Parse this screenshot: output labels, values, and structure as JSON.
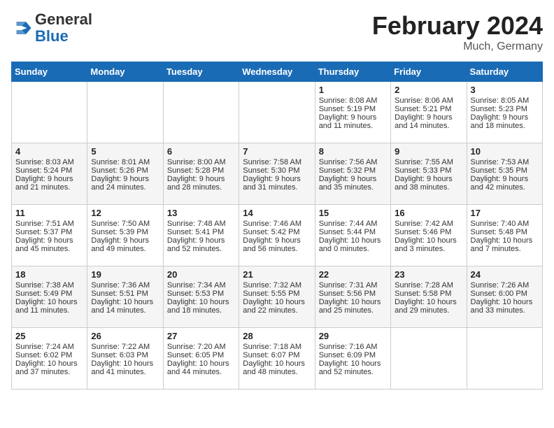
{
  "header": {
    "logo_general": "General",
    "logo_blue": "Blue",
    "title": "February 2024",
    "location": "Much, Germany"
  },
  "weekdays": [
    "Sunday",
    "Monday",
    "Tuesday",
    "Wednesday",
    "Thursday",
    "Friday",
    "Saturday"
  ],
  "weeks": [
    [
      {
        "day": "",
        "info": ""
      },
      {
        "day": "",
        "info": ""
      },
      {
        "day": "",
        "info": ""
      },
      {
        "day": "",
        "info": ""
      },
      {
        "day": "1",
        "info": "Sunrise: 8:08 AM\nSunset: 5:19 PM\nDaylight: 9 hours\nand 11 minutes."
      },
      {
        "day": "2",
        "info": "Sunrise: 8:06 AM\nSunset: 5:21 PM\nDaylight: 9 hours\nand 14 minutes."
      },
      {
        "day": "3",
        "info": "Sunrise: 8:05 AM\nSunset: 5:23 PM\nDaylight: 9 hours\nand 18 minutes."
      }
    ],
    [
      {
        "day": "4",
        "info": "Sunrise: 8:03 AM\nSunset: 5:24 PM\nDaylight: 9 hours\nand 21 minutes."
      },
      {
        "day": "5",
        "info": "Sunrise: 8:01 AM\nSunset: 5:26 PM\nDaylight: 9 hours\nand 24 minutes."
      },
      {
        "day": "6",
        "info": "Sunrise: 8:00 AM\nSunset: 5:28 PM\nDaylight: 9 hours\nand 28 minutes."
      },
      {
        "day": "7",
        "info": "Sunrise: 7:58 AM\nSunset: 5:30 PM\nDaylight: 9 hours\nand 31 minutes."
      },
      {
        "day": "8",
        "info": "Sunrise: 7:56 AM\nSunset: 5:32 PM\nDaylight: 9 hours\nand 35 minutes."
      },
      {
        "day": "9",
        "info": "Sunrise: 7:55 AM\nSunset: 5:33 PM\nDaylight: 9 hours\nand 38 minutes."
      },
      {
        "day": "10",
        "info": "Sunrise: 7:53 AM\nSunset: 5:35 PM\nDaylight: 9 hours\nand 42 minutes."
      }
    ],
    [
      {
        "day": "11",
        "info": "Sunrise: 7:51 AM\nSunset: 5:37 PM\nDaylight: 9 hours\nand 45 minutes."
      },
      {
        "day": "12",
        "info": "Sunrise: 7:50 AM\nSunset: 5:39 PM\nDaylight: 9 hours\nand 49 minutes."
      },
      {
        "day": "13",
        "info": "Sunrise: 7:48 AM\nSunset: 5:41 PM\nDaylight: 9 hours\nand 52 minutes."
      },
      {
        "day": "14",
        "info": "Sunrise: 7:46 AM\nSunset: 5:42 PM\nDaylight: 9 hours\nand 56 minutes."
      },
      {
        "day": "15",
        "info": "Sunrise: 7:44 AM\nSunset: 5:44 PM\nDaylight: 10 hours\nand 0 minutes."
      },
      {
        "day": "16",
        "info": "Sunrise: 7:42 AM\nSunset: 5:46 PM\nDaylight: 10 hours\nand 3 minutes."
      },
      {
        "day": "17",
        "info": "Sunrise: 7:40 AM\nSunset: 5:48 PM\nDaylight: 10 hours\nand 7 minutes."
      }
    ],
    [
      {
        "day": "18",
        "info": "Sunrise: 7:38 AM\nSunset: 5:49 PM\nDaylight: 10 hours\nand 11 minutes."
      },
      {
        "day": "19",
        "info": "Sunrise: 7:36 AM\nSunset: 5:51 PM\nDaylight: 10 hours\nand 14 minutes."
      },
      {
        "day": "20",
        "info": "Sunrise: 7:34 AM\nSunset: 5:53 PM\nDaylight: 10 hours\nand 18 minutes."
      },
      {
        "day": "21",
        "info": "Sunrise: 7:32 AM\nSunset: 5:55 PM\nDaylight: 10 hours\nand 22 minutes."
      },
      {
        "day": "22",
        "info": "Sunrise: 7:31 AM\nSunset: 5:56 PM\nDaylight: 10 hours\nand 25 minutes."
      },
      {
        "day": "23",
        "info": "Sunrise: 7:28 AM\nSunset: 5:58 PM\nDaylight: 10 hours\nand 29 minutes."
      },
      {
        "day": "24",
        "info": "Sunrise: 7:26 AM\nSunset: 6:00 PM\nDaylight: 10 hours\nand 33 minutes."
      }
    ],
    [
      {
        "day": "25",
        "info": "Sunrise: 7:24 AM\nSunset: 6:02 PM\nDaylight: 10 hours\nand 37 minutes."
      },
      {
        "day": "26",
        "info": "Sunrise: 7:22 AM\nSunset: 6:03 PM\nDaylight: 10 hours\nand 41 minutes."
      },
      {
        "day": "27",
        "info": "Sunrise: 7:20 AM\nSunset: 6:05 PM\nDaylight: 10 hours\nand 44 minutes."
      },
      {
        "day": "28",
        "info": "Sunrise: 7:18 AM\nSunset: 6:07 PM\nDaylight: 10 hours\nand 48 minutes."
      },
      {
        "day": "29",
        "info": "Sunrise: 7:16 AM\nSunset: 6:09 PM\nDaylight: 10 hours\nand 52 minutes."
      },
      {
        "day": "",
        "info": ""
      },
      {
        "day": "",
        "info": ""
      }
    ]
  ]
}
